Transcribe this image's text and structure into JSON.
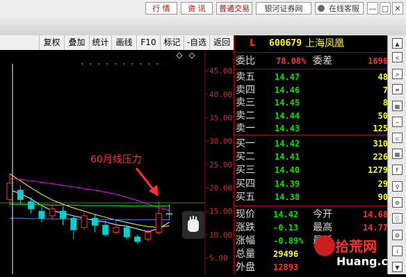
{
  "top_bar": {
    "buttons": [
      "行 情",
      "资 讯",
      "普通交易",
      "银河证券网",
      "在线客服"
    ],
    "window_controls": [
      "minimize-icon",
      "restore-icon",
      "close-icon"
    ]
  },
  "toolbar": {
    "items": [
      "复权",
      "叠加",
      "统计",
      "画线",
      "F10",
      "标记",
      "-自选",
      "返回"
    ]
  },
  "chart": {
    "annotation": "60月线压力",
    "ytick_labels": [
      "45.00",
      "40.00",
      "35.00",
      "30.00",
      "25.00",
      "20.00",
      "15.00",
      "10.00",
      "5.00"
    ]
  },
  "chart_data": {
    "type": "candlestick",
    "ylim": [
      3,
      48
    ],
    "y_ticks": [
      45,
      40,
      35,
      30,
      25,
      20,
      15,
      10,
      5
    ],
    "candles": [
      {
        "o": 17.5,
        "c": 21.0,
        "h": 23.0,
        "l": 16.0,
        "up": true
      },
      {
        "o": 19.5,
        "c": 17.5,
        "h": 20.5,
        "l": 16.5,
        "up": false
      },
      {
        "o": 17.0,
        "c": 15.5,
        "h": 18.0,
        "l": 14.5,
        "up": false
      },
      {
        "o": 15.0,
        "c": 13.5,
        "h": 16.0,
        "l": 12.5,
        "up": false
      },
      {
        "o": 14.0,
        "c": 15.5,
        "h": 16.5,
        "l": 13.0,
        "up": true
      },
      {
        "o": 15.0,
        "c": 13.5,
        "h": 16.0,
        "l": 12.0,
        "up": false
      },
      {
        "o": 13.5,
        "c": 11.0,
        "h": 14.0,
        "l": 9.0,
        "up": false
      },
      {
        "o": 11.5,
        "c": 14.0,
        "h": 15.0,
        "l": 11.0,
        "up": true
      },
      {
        "o": 13.5,
        "c": 12.0,
        "h": 14.5,
        "l": 10.5,
        "up": false
      },
      {
        "o": 12.0,
        "c": 10.0,
        "h": 13.0,
        "l": 9.5,
        "up": false
      },
      {
        "o": 10.5,
        "c": 11.5,
        "h": 13.0,
        "l": 10.0,
        "up": true
      },
      {
        "o": 11.5,
        "c": 9.5,
        "h": 12.0,
        "l": 9.0,
        "up": false
      },
      {
        "o": 9.5,
        "c": 8.5,
        "h": 10.0,
        "l": 8.0,
        "up": false
      },
      {
        "o": 9.0,
        "c": 10.5,
        "h": 11.0,
        "l": 8.5,
        "up": true
      },
      {
        "o": 10.5,
        "c": 14.5,
        "h": 17.0,
        "l": 10.0,
        "up": true
      },
      {
        "o": 14.5,
        "c": 14.4,
        "h": 16.5,
        "l": 13.0,
        "up": false
      }
    ],
    "moving_averages": [
      {
        "color": "#ffffff",
        "values": [
          19.5,
          18.8,
          17.6,
          16.2,
          15.1,
          14.6,
          14.0,
          13.5,
          13.0,
          12.7,
          12.1,
          11.8,
          11.2,
          10.6,
          11.3,
          12.6
        ]
      },
      {
        "color": "#ffff00",
        "values": [
          23.0,
          21.5,
          20.0,
          18.6,
          17.4,
          16.5,
          15.7,
          15.0,
          14.3,
          13.7,
          13.1,
          12.6,
          12.1,
          11.7,
          11.5,
          11.9
        ]
      },
      {
        "color": "#ff00ff",
        "values": [
          22.0,
          21.8,
          21.5,
          21.2,
          20.9,
          20.5,
          20.2,
          19.8,
          19.5,
          19.1,
          18.6,
          18.0,
          17.3,
          16.5,
          15.8,
          15.2
        ]
      },
      {
        "color": "#00ff00",
        "values": [
          16.5,
          16.5,
          16.4,
          16.4,
          16.3,
          16.3,
          16.3,
          16.2,
          16.2,
          16.2,
          16.2,
          16.1,
          16.1,
          16.1,
          16.1,
          16.1
        ]
      },
      {
        "color": "#4080ff",
        "values": [
          13.5,
          13.5,
          13.4,
          13.4,
          13.4,
          13.3,
          13.3,
          13.3,
          13.3,
          13.2,
          13.2,
          13.2,
          13.2,
          13.2,
          13.2,
          13.2
        ]
      }
    ]
  },
  "quote": {
    "market_prefix": "L",
    "code": "600679",
    "name": "上海凤凰",
    "weibi_label": "委比",
    "weibi_value": "78.08%",
    "weicha_label": "委差",
    "weicha_value": "1696",
    "sell": [
      {
        "label": "卖五",
        "price": "14.47",
        "vol": "48"
      },
      {
        "label": "卖四",
        "price": "14.46",
        "vol": "7"
      },
      {
        "label": "卖三",
        "price": "14.45",
        "vol": "8"
      },
      {
        "label": "卖二",
        "price": "14.44",
        "vol": "50"
      },
      {
        "label": "卖一",
        "price": "14.43",
        "vol": "125"
      }
    ],
    "buy": [
      {
        "label": "买一",
        "price": "14.42",
        "vol": "310"
      },
      {
        "label": "买二",
        "price": "14.41",
        "vol": "226"
      },
      {
        "label": "买三",
        "price": "14.40",
        "vol": "1279"
      },
      {
        "label": "买四",
        "price": "14.39",
        "vol": "29"
      },
      {
        "label": "买五",
        "price": "14.38",
        "vol": "90"
      }
    ],
    "stats": [
      {
        "l1": "现价",
        "v1": "14.42",
        "c1": "green",
        "l2": "今开",
        "v2": "14.68",
        "c2": "red-t"
      },
      {
        "l1": "涨跌",
        "v1": "-0.13",
        "c1": "green",
        "l2": "最高",
        "v2": "14.77",
        "c2": "red-t"
      },
      {
        "l1": "涨幅",
        "v1": "-0.89%",
        "c1": "green",
        "l2": "最低",
        "v2": "",
        "c2": "green"
      },
      {
        "l1": "总量",
        "v1": "29496",
        "c1": "yellow",
        "l2": "",
        "v2": "",
        "c2": "yellow"
      },
      {
        "l1": "外盘",
        "v1": "12893",
        "c1": "red-t",
        "l2": "",
        "v2": "",
        "c2": "red-t"
      }
    ]
  },
  "watermark": {
    "brand": "拾荒网",
    "url": "Huang.cn"
  },
  "colors": {
    "up": "#ff3030",
    "down": "#00d0d0",
    "axis": "#a00000"
  }
}
